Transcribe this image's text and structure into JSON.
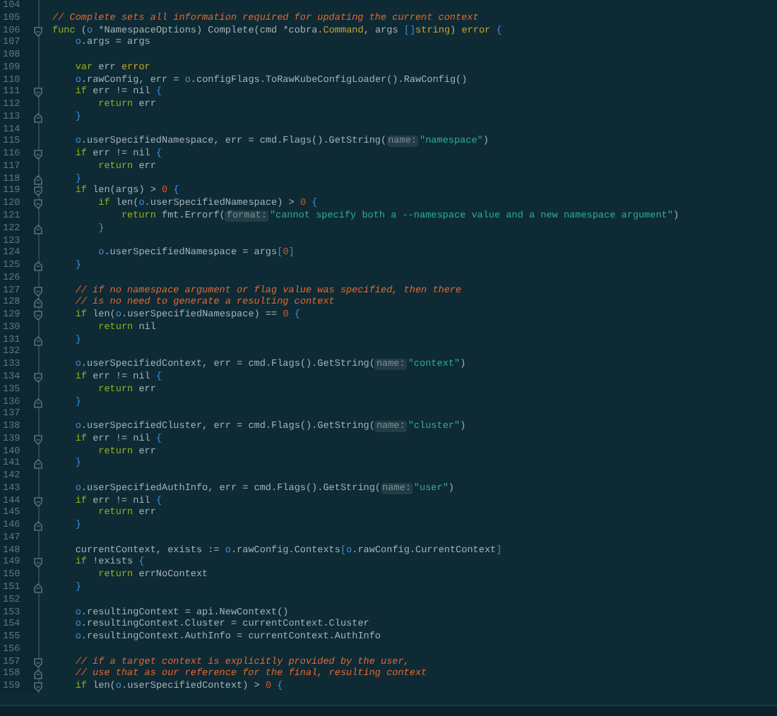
{
  "editor": {
    "lines": [
      {
        "number": "104",
        "kind": "plain"
      },
      {
        "number": "105",
        "kind": "plain",
        "tokens": [
          {
            "kind": "comment",
            "text": "// Complete sets all information required for updating the current context"
          }
        ]
      },
      {
        "number": "106",
        "kind": "fold_start",
        "tokens": [
          {
            "kind": "keyword",
            "text": "func"
          },
          {
            "kind": "plain",
            "text": " ("
          },
          {
            "kind": "ident",
            "text": "o"
          },
          {
            "kind": "plain",
            "text": " *NamespaceOptions) Complete(cmd *cobra."
          },
          {
            "kind": "type",
            "text": "Command"
          },
          {
            "kind": "plain",
            "text": ", args "
          },
          {
            "kind": "ident",
            "text": "[]"
          },
          {
            "kind": "type",
            "text": "string"
          },
          {
            "kind": "plain",
            "text": ") "
          },
          {
            "kind": "type",
            "text": "error"
          },
          {
            "kind": "ident",
            "text": " {"
          }
        ]
      },
      {
        "number": "107",
        "kind": "plain",
        "tokens": [
          {
            "kind": "ident",
            "text": "    o"
          },
          {
            "kind": "plain",
            "text": ".args = args"
          }
        ]
      },
      {
        "number": "108",
        "kind": "plain"
      },
      {
        "number": "109",
        "kind": "plain",
        "tokens": [
          {
            "kind": "keyword",
            "text": "    var"
          },
          {
            "kind": "plain",
            "text": " err "
          },
          {
            "kind": "type",
            "text": "error"
          }
        ]
      },
      {
        "number": "110",
        "kind": "plain",
        "tokens": [
          {
            "kind": "ident",
            "text": "    o"
          },
          {
            "kind": "plain",
            "text": ".rawConfig, err = "
          },
          {
            "kind": "ident",
            "text": "o"
          },
          {
            "kind": "plain",
            "text": ".configFlags.ToRawKubeConfigLoader().RawConfig()"
          }
        ]
      },
      {
        "number": "111",
        "kind": "fold_start",
        "tokens": [
          {
            "kind": "keyword",
            "text": "    if"
          },
          {
            "kind": "plain",
            "text": " err != nil "
          },
          {
            "kind": "ident",
            "text": "{"
          }
        ]
      },
      {
        "number": "112",
        "kind": "plain",
        "tokens": [
          {
            "kind": "keyword",
            "text": "        return"
          },
          {
            "kind": "plain",
            "text": " err"
          }
        ]
      },
      {
        "number": "113",
        "kind": "fold_end",
        "tokens": [
          {
            "kind": "ident",
            "text": "    }"
          }
        ]
      },
      {
        "number": "114",
        "kind": "plain"
      },
      {
        "number": "115",
        "kind": "plain",
        "tokens": [
          {
            "kind": "ident",
            "text": "    o"
          },
          {
            "kind": "plain",
            "text": ".userSpecifiedNamespace, err = cmd.Flags().GetString("
          },
          {
            "kind": "hint",
            "text": "name:"
          },
          {
            "kind": "string",
            "text": "\"namespace\""
          },
          {
            "kind": "plain",
            "text": ")"
          }
        ]
      },
      {
        "number": "116",
        "kind": "fold_start",
        "tokens": [
          {
            "kind": "keyword",
            "text": "    if"
          },
          {
            "kind": "plain",
            "text": " err != nil "
          },
          {
            "kind": "ident",
            "text": "{"
          }
        ]
      },
      {
        "number": "117",
        "kind": "plain",
        "tokens": [
          {
            "kind": "keyword",
            "text": "        return"
          },
          {
            "kind": "plain",
            "text": " err"
          }
        ]
      },
      {
        "number": "118",
        "kind": "fold_end",
        "tokens": [
          {
            "kind": "ident",
            "text": "    }"
          }
        ]
      },
      {
        "number": "119",
        "kind": "fold_start",
        "tokens": [
          {
            "kind": "keyword",
            "text": "    if"
          },
          {
            "kind": "plain",
            "text": " len(args) > "
          },
          {
            "kind": "number",
            "text": "0"
          },
          {
            "kind": "ident",
            "text": " {"
          }
        ]
      },
      {
        "number": "120",
        "kind": "fold_start",
        "tokens": [
          {
            "kind": "keyword",
            "text": "        if"
          },
          {
            "kind": "plain",
            "text": " len("
          },
          {
            "kind": "ident",
            "text": "o"
          },
          {
            "kind": "plain",
            "text": ".userSpecifiedNamespace) > "
          },
          {
            "kind": "number",
            "text": "0"
          },
          {
            "kind": "ident",
            "text": " {"
          }
        ]
      },
      {
        "number": "121",
        "kind": "plain",
        "tokens": [
          {
            "kind": "keyword",
            "text": "            return"
          },
          {
            "kind": "plain",
            "text": " fmt.Errorf("
          },
          {
            "kind": "hint",
            "text": "format:"
          },
          {
            "kind": "string",
            "text": "\"cannot specify both a --namespace value and a new namespace argument\""
          },
          {
            "kind": "plain",
            "text": ")"
          }
        ]
      },
      {
        "number": "122",
        "kind": "fold_end",
        "tokens": [
          {
            "kind": "ident",
            "text": "        }"
          }
        ]
      },
      {
        "number": "123",
        "kind": "plain"
      },
      {
        "number": "124",
        "kind": "plain",
        "tokens": [
          {
            "kind": "ident",
            "text": "        o"
          },
          {
            "kind": "plain",
            "text": ".userSpecifiedNamespace = args"
          },
          {
            "kind": "ident",
            "text": "["
          },
          {
            "kind": "number",
            "text": "0"
          },
          {
            "kind": "ident",
            "text": "]"
          }
        ]
      },
      {
        "number": "125",
        "kind": "fold_end",
        "tokens": [
          {
            "kind": "ident",
            "text": "    }"
          }
        ]
      },
      {
        "number": "126",
        "kind": "plain"
      },
      {
        "number": "127",
        "kind": "fold_start",
        "tokens": [
          {
            "kind": "comment",
            "text": "    // if no namespace argument or flag value was specified, then there"
          }
        ]
      },
      {
        "number": "128",
        "kind": "fold_end",
        "tokens": [
          {
            "kind": "comment",
            "text": "    // is no need to generate a resulting context"
          }
        ]
      },
      {
        "number": "129",
        "kind": "fold_start",
        "tokens": [
          {
            "kind": "keyword",
            "text": "    if"
          },
          {
            "kind": "plain",
            "text": " len("
          },
          {
            "kind": "ident",
            "text": "o"
          },
          {
            "kind": "plain",
            "text": ".userSpecifiedNamespace) == "
          },
          {
            "kind": "number",
            "text": "0"
          },
          {
            "kind": "ident",
            "text": " {"
          }
        ]
      },
      {
        "number": "130",
        "kind": "plain",
        "tokens": [
          {
            "kind": "keyword",
            "text": "        return"
          },
          {
            "kind": "plain",
            "text": " nil"
          }
        ]
      },
      {
        "number": "131",
        "kind": "fold_end",
        "tokens": [
          {
            "kind": "ident",
            "text": "    }"
          }
        ]
      },
      {
        "number": "132",
        "kind": "plain"
      },
      {
        "number": "133",
        "kind": "plain",
        "tokens": [
          {
            "kind": "ident",
            "text": "    o"
          },
          {
            "kind": "plain",
            "text": ".userSpecifiedContext, err = cmd.Flags().GetString("
          },
          {
            "kind": "hint",
            "text": "name:"
          },
          {
            "kind": "string",
            "text": "\"context\""
          },
          {
            "kind": "plain",
            "text": ")"
          }
        ]
      },
      {
        "number": "134",
        "kind": "fold_start",
        "tokens": [
          {
            "kind": "keyword",
            "text": "    if"
          },
          {
            "kind": "plain",
            "text": " err != nil "
          },
          {
            "kind": "ident",
            "text": "{"
          }
        ]
      },
      {
        "number": "135",
        "kind": "plain",
        "tokens": [
          {
            "kind": "keyword",
            "text": "        return"
          },
          {
            "kind": "plain",
            "text": " err"
          }
        ]
      },
      {
        "number": "136",
        "kind": "fold_end",
        "tokens": [
          {
            "kind": "ident",
            "text": "    }"
          }
        ]
      },
      {
        "number": "137",
        "kind": "plain"
      },
      {
        "number": "138",
        "kind": "plain",
        "tokens": [
          {
            "kind": "ident",
            "text": "    o"
          },
          {
            "kind": "plain",
            "text": ".userSpecifiedCluster, err = cmd.Flags().GetString("
          },
          {
            "kind": "hint",
            "text": "name:"
          },
          {
            "kind": "string",
            "text": "\"cluster\""
          },
          {
            "kind": "plain",
            "text": ")"
          }
        ]
      },
      {
        "number": "139",
        "kind": "fold_start",
        "tokens": [
          {
            "kind": "keyword",
            "text": "    if"
          },
          {
            "kind": "plain",
            "text": " err != nil "
          },
          {
            "kind": "ident",
            "text": "{"
          }
        ]
      },
      {
        "number": "140",
        "kind": "plain",
        "tokens": [
          {
            "kind": "keyword",
            "text": "        return"
          },
          {
            "kind": "plain",
            "text": " err"
          }
        ]
      },
      {
        "number": "141",
        "kind": "fold_end",
        "tokens": [
          {
            "kind": "ident",
            "text": "    }"
          }
        ]
      },
      {
        "number": "142",
        "kind": "plain"
      },
      {
        "number": "143",
        "kind": "plain",
        "tokens": [
          {
            "kind": "ident",
            "text": "    o"
          },
          {
            "kind": "plain",
            "text": ".userSpecifiedAuthInfo, err = cmd.Flags().GetString("
          },
          {
            "kind": "hint",
            "text": "name:"
          },
          {
            "kind": "string",
            "text": "\"user\""
          },
          {
            "kind": "plain",
            "text": ")"
          }
        ]
      },
      {
        "number": "144",
        "kind": "fold_start",
        "tokens": [
          {
            "kind": "keyword",
            "text": "    if"
          },
          {
            "kind": "plain",
            "text": " err != nil "
          },
          {
            "kind": "ident",
            "text": "{"
          }
        ]
      },
      {
        "number": "145",
        "kind": "plain",
        "tokens": [
          {
            "kind": "keyword",
            "text": "        return"
          },
          {
            "kind": "plain",
            "text": " err"
          }
        ]
      },
      {
        "number": "146",
        "kind": "fold_end",
        "tokens": [
          {
            "kind": "ident",
            "text": "    }"
          }
        ]
      },
      {
        "number": "147",
        "kind": "plain"
      },
      {
        "number": "148",
        "kind": "plain",
        "tokens": [
          {
            "kind": "plain",
            "text": "    currentContext, exists := "
          },
          {
            "kind": "ident",
            "text": "o"
          },
          {
            "kind": "plain",
            "text": ".rawConfig.Contexts"
          },
          {
            "kind": "ident",
            "text": "[o"
          },
          {
            "kind": "plain",
            "text": ".rawConfig.CurrentContext"
          },
          {
            "kind": "ident",
            "text": "]"
          }
        ]
      },
      {
        "number": "149",
        "kind": "fold_start",
        "tokens": [
          {
            "kind": "keyword",
            "text": "    if"
          },
          {
            "kind": "plain",
            "text": " !exists "
          },
          {
            "kind": "ident",
            "text": "{"
          }
        ]
      },
      {
        "number": "150",
        "kind": "plain",
        "tokens": [
          {
            "kind": "keyword",
            "text": "        return"
          },
          {
            "kind": "plain",
            "text": " errNoContext"
          }
        ]
      },
      {
        "number": "151",
        "kind": "fold_end",
        "tokens": [
          {
            "kind": "ident",
            "text": "    }"
          }
        ]
      },
      {
        "number": "152",
        "kind": "plain"
      },
      {
        "number": "153",
        "kind": "plain",
        "tokens": [
          {
            "kind": "ident",
            "text": "    o"
          },
          {
            "kind": "plain",
            "text": ".resultingContext = api.NewContext()"
          }
        ]
      },
      {
        "number": "154",
        "kind": "plain",
        "tokens": [
          {
            "kind": "ident",
            "text": "    o"
          },
          {
            "kind": "plain",
            "text": ".resultingContext.Cluster = currentContext.Cluster"
          }
        ]
      },
      {
        "number": "155",
        "kind": "plain",
        "tokens": [
          {
            "kind": "ident",
            "text": "    o"
          },
          {
            "kind": "plain",
            "text": ".resultingContext.AuthInfo = currentContext.AuthInfo"
          }
        ]
      },
      {
        "number": "156",
        "kind": "plain"
      },
      {
        "number": "157",
        "kind": "fold_start",
        "tokens": [
          {
            "kind": "comment",
            "text": "    // if a target context is explicitly provided by the user,"
          }
        ]
      },
      {
        "number": "158",
        "kind": "fold_end",
        "tokens": [
          {
            "kind": "comment",
            "text": "    // use that as our reference for the final, resulting context"
          }
        ]
      },
      {
        "number": "159",
        "kind": "fold_start",
        "tokens": [
          {
            "kind": "keyword",
            "text": "    if"
          },
          {
            "kind": "plain",
            "text": " len("
          },
          {
            "kind": "ident",
            "text": "o"
          },
          {
            "kind": "plain",
            "text": ".userSpecifiedContext) > "
          },
          {
            "kind": "number",
            "text": "0"
          },
          {
            "kind": "ident",
            "text": " {"
          }
        ]
      }
    ]
  }
}
